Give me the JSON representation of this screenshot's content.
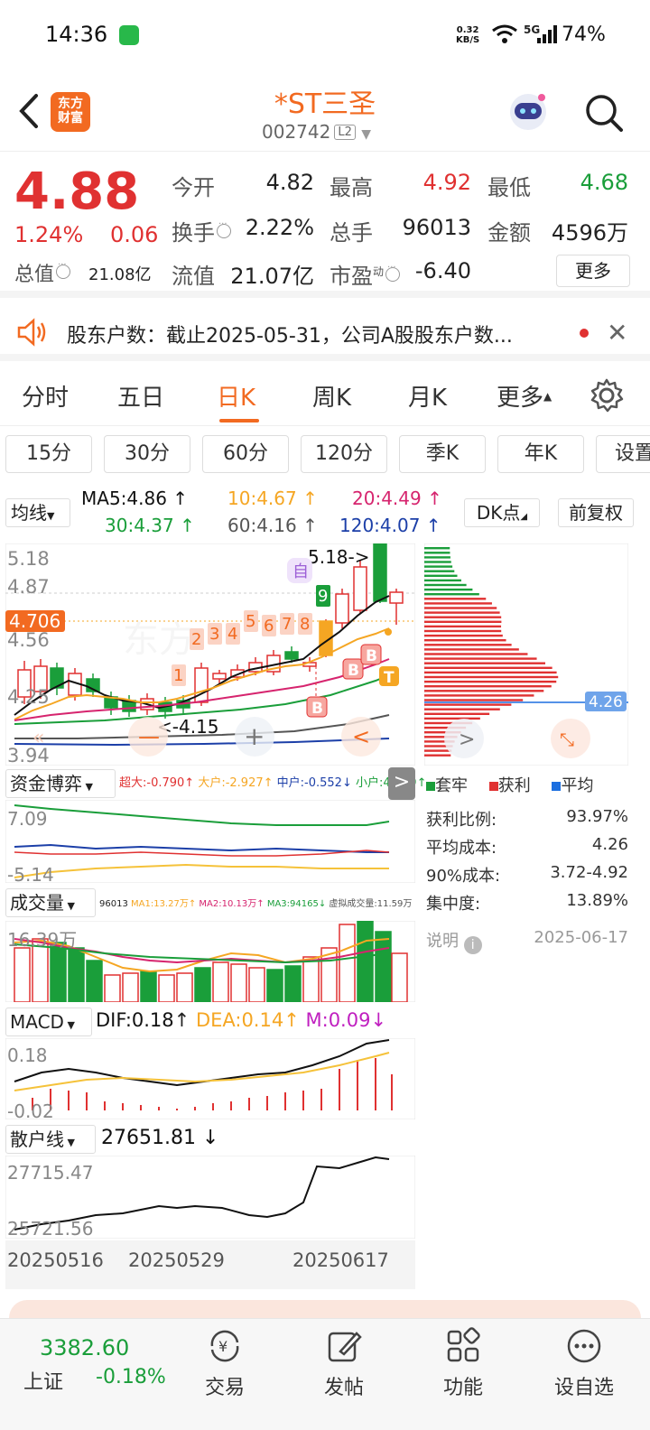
{
  "status": {
    "time": "14:36",
    "speed_top": "0.32",
    "speed_bottom": "KB/S",
    "network": "5G",
    "battery": "74%"
  },
  "header": {
    "logo_line1": "东方",
    "logo_line2": "财富",
    "name": "*ST三圣",
    "code": "002742",
    "code_badge": "L2"
  },
  "quote": {
    "price": "4.88",
    "change_pct": "1.24%",
    "change": "0.06",
    "mcap_label": "总值",
    "mcap_value": "21.08亿",
    "open_label": "今开",
    "open": "4.82",
    "high_label": "最高",
    "high": "4.92",
    "low_label": "最低",
    "low": "4.68",
    "turnover_label": "换手",
    "turnover": "2.22%",
    "volume_label": "总手",
    "volume": "96013",
    "amount_label": "金额",
    "amount": "4596万",
    "float_label": "流值",
    "float_value": "21.07亿",
    "pe_label": "市盈",
    "pe_sup": "动",
    "pe": "-6.40",
    "more": "更多"
  },
  "notice": {
    "text": "股东户数：截止2025-05-31，公司A股股东户数..."
  },
  "period_tabs": [
    "分时",
    "五日",
    "日K",
    "周K",
    "月K",
    "更多"
  ],
  "active_period": "日K",
  "sub_tabs": [
    "15分",
    "30分",
    "60分",
    "120分",
    "季K",
    "年K",
    "设置"
  ],
  "ma": {
    "selector": "均线",
    "ma5": "MA5:4.86",
    "ma10": "10:4.67",
    "ma20": "20:4.49",
    "ma30": "30:4.37",
    "ma60": "60:4.16",
    "ma120": "120:4.07",
    "dk": "DK点",
    "adjust": "前复权"
  },
  "kline": {
    "y_top": "5.18",
    "y_2": "4.87",
    "y_cur": "4.706",
    "y_3": "4.56",
    "y_4": "4.25",
    "y_bottom": "3.94",
    "high_mark": "5.18",
    "low_mark": "<-4.15",
    "chip_cost": "4.26",
    "self_tag": "自",
    "counts": [
      "1",
      "2",
      "3",
      "4",
      "5",
      "6",
      "7",
      "8",
      "9"
    ],
    "b_tags": [
      "B",
      "B",
      "B"
    ],
    "t_tag": "T"
  },
  "funds": {
    "selector": "资金博弈",
    "super": "超大:-0.790",
    "big": "大户:-2.927",
    "mid": "中户:-0.552",
    "small": "小户:4.269",
    "y_top": "7.09",
    "y_bottom": "-5.14"
  },
  "volume": {
    "selector": "成交量",
    "total": "96013",
    "ma1": "MA1:13.27万",
    "ma2": "MA2:10.13万",
    "ma3": "MA3:94165",
    "virtual": "虚拟成交量:11.59万",
    "y_top": "16.39万"
  },
  "macd": {
    "selector": "MACD",
    "dif": "DIF:0.18",
    "dea": "DEA:0.14",
    "m": "M:0.09",
    "y_top": "0.18",
    "y_bottom": "-0.02"
  },
  "retail": {
    "selector": "散户线",
    "value": "27651.81",
    "y_top": "27715.47",
    "y_bottom": "25721.56"
  },
  "dates": [
    "20250516",
    "20250529",
    "20250617"
  ],
  "chips": {
    "legend": [
      "套牢",
      "获利",
      "平均"
    ],
    "stats": [
      {
        "label": "获利比例:",
        "value": "93.97%"
      },
      {
        "label": "平均成本:",
        "value": "4.26"
      },
      {
        "label": "90%成本:",
        "value": "3.72-4.92"
      },
      {
        "label": "集中度:",
        "value": "13.89%"
      }
    ],
    "note_label": "说明",
    "date": "2025-06-17"
  },
  "bottom": {
    "index_value": "3382.60",
    "index_name": "上证",
    "index_pct": "-0.18%",
    "nav": [
      "交易",
      "发帖",
      "功能",
      "设自选"
    ]
  },
  "colors": {
    "up": "#e03131",
    "down": "#1a9e3a",
    "brand": "#f26a21"
  }
}
